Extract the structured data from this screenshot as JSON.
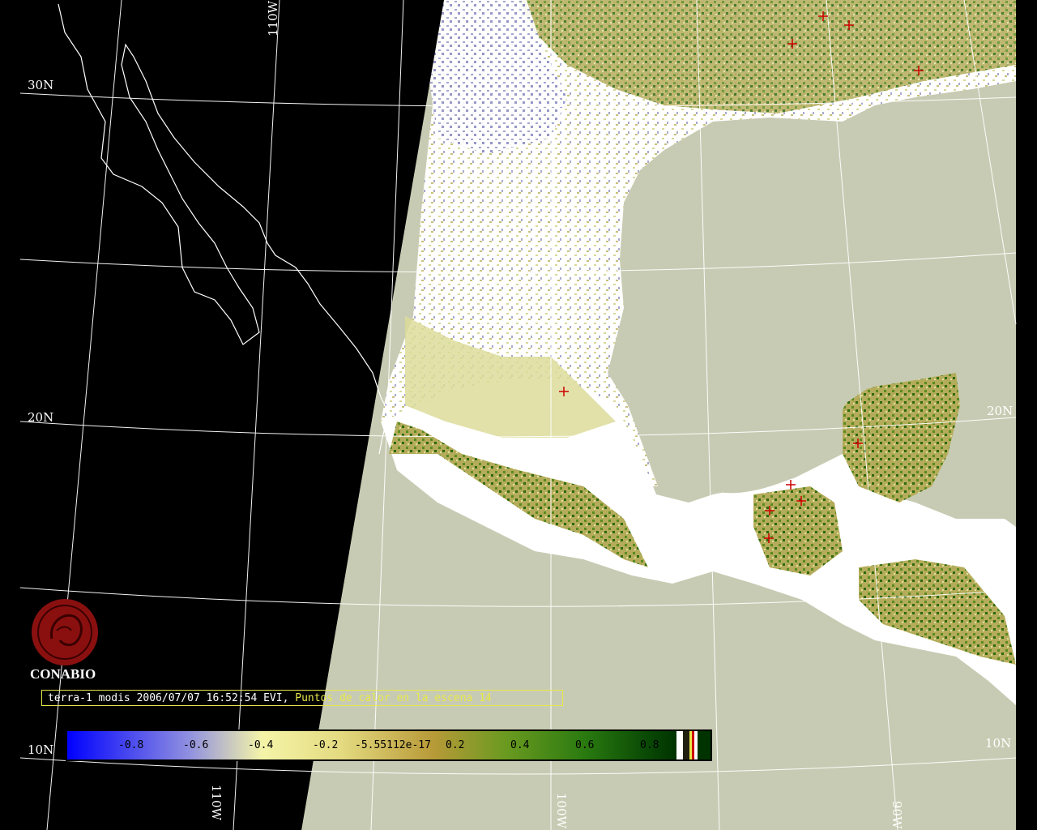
{
  "map": {
    "graticule_labels": {
      "lat_30n": "30N",
      "lat_20n_left": "20N",
      "lat_20n_right": "20N",
      "lat_10n_left": "10N",
      "lat_10n_right": "10N",
      "lon_110w_top": "110W",
      "lon_110w_bottom": "110W",
      "lon_100w": "100W",
      "lon_90w": "90W"
    },
    "hotspot_marker": "+"
  },
  "logo": {
    "name": "CONABIO"
  },
  "caption": {
    "satellite_info": "terra-1 modis 2006/07/07 16:52:54 EVI,",
    "hotspots_info": " Puntos de calor en la escena 14"
  },
  "colorbar": {
    "ticks": [
      "-0.8",
      "-0.6",
      "-0.4",
      "-0.2",
      "-5.55112e-17",
      "0.2",
      "0.4",
      "0.6",
      "0.8"
    ],
    "colors": {
      "low": "#0000ff",
      "mid_low": "#f4f4a0",
      "zero": "#b8a040",
      "mid_high": "#3a8a10",
      "high": "#003300",
      "ocean": "#c8cbb3",
      "cloud": "#ffffff",
      "hotspot": "#cc0000"
    }
  }
}
